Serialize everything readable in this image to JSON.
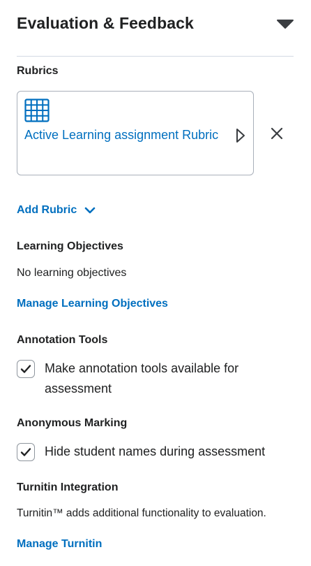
{
  "panel": {
    "title": "Evaluation & Feedback",
    "collapse_icon": "caret-down-icon"
  },
  "rubrics": {
    "heading": "Rubrics",
    "items": [
      {
        "name": "Active Learning assignment Rubric",
        "icon": "grid-icon",
        "expand_icon": "caret-right-outline-icon",
        "remove_icon": "close-icon"
      }
    ],
    "add_label": "Add Rubric",
    "add_icon": "chevron-down-icon"
  },
  "learning_objectives": {
    "heading": "Learning Objectives",
    "empty_text": "No learning objectives",
    "manage_label": "Manage Learning Objectives"
  },
  "annotation_tools": {
    "heading": "Annotation Tools",
    "checkbox_label_line1": "Make annotation tools available for",
    "checkbox_label_line2": "assessment",
    "checked": true
  },
  "anonymous_marking": {
    "heading": "Anonymous Marking",
    "checkbox_label": "Hide student names during assessment",
    "checked": true
  },
  "turnitin": {
    "heading": "Turnitin Integration",
    "description": "Turnitin™ adds additional functionality to evaluation.",
    "manage_label": "Manage Turnitin"
  },
  "colors": {
    "link": "#006fbf",
    "text": "#202122",
    "border": "#a9b0ba",
    "divider": "#d3d9e3"
  }
}
